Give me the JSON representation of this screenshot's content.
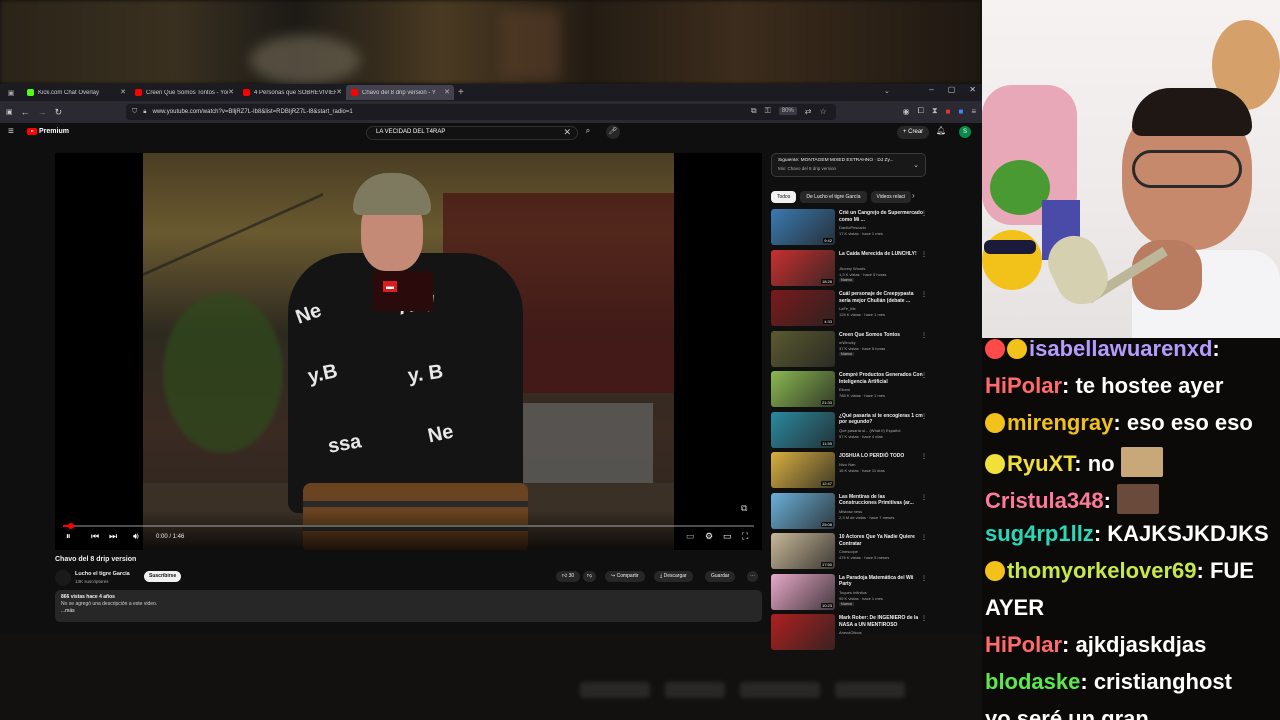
{
  "browser": {
    "tabs": [
      {
        "label": "Kick.com Chat Overlay",
        "color": "#53fc18"
      },
      {
        "label": "Creen Que Somos Tontos - You",
        "color": "#ff0000"
      },
      {
        "label": "4 Personas que SOBREVIVIERON",
        "color": "#ff0000"
      },
      {
        "label": "Chavo del 8 drip version - Y",
        "color": "#ff0000"
      }
    ],
    "url": "www.youtube.com/watch?v=BlljRZ7L-Ib8&list=RDBIjRZ7L-I8&start_radio=1",
    "zoom": "80%"
  },
  "youtube": {
    "logo": "Premium",
    "search_query": "LA VECIDAD DEL T4RAP",
    "create_label": "+ Crear",
    "avatar_letter": "S"
  },
  "video": {
    "time": "0:00 / 1:46",
    "progress": 0.012,
    "title": "Chavo del 8 drip version",
    "channel": "Lucho el tigre García",
    "subs": "13K suscriptores",
    "subscribe_label": "Suscribirse",
    "likes": "30",
    "share_label": "Compartir",
    "download_label": "Descargar",
    "save_label": "Guardar",
    "views": "866 vistas  hace 4 años",
    "description": "No se agregó una descripción a este video.",
    "more": "...más"
  },
  "upnext": {
    "line1": "Siguiente: MONTAGEM MIXED ESTRAHNO · DJ Zy...",
    "line2": "Mix: Chavo del 8 drip version"
  },
  "chips": [
    "Todos",
    "De Lucho el tigre García",
    "Videos relaci"
  ],
  "recommendations": [
    {
      "title": "Crié un Cangrejo de Supermercado como Mi ...",
      "channel": "DaniloPescado",
      "meta": "17 K vistas · hace 1 mes",
      "duration": "9:42",
      "thumb": "#3a7ab0",
      "nuevo": false
    },
    {
      "title": "La Caída Merecida de LUNCHLY!",
      "channel": "Jhonny Woods",
      "meta": "1,3 K vistas · hace 5 horas",
      "duration": "18:28",
      "thumb": "#c83030",
      "nuevo": true
    },
    {
      "title": "Cuál personaje de Creepypasta sería mejor Chulián (debate ...",
      "channel": "LaFe_Mx",
      "meta": "128 K vistas · hace 1 mes",
      "duration": "4:33",
      "thumb": "#7a1a1a",
      "nuevo": false
    },
    {
      "title": "Creen Que Somos Tontos",
      "channel": "mWrocky",
      "meta": "37 K vistas · hace 5 horas",
      "duration": "",
      "thumb": "#5a5a30",
      "nuevo": true
    },
    {
      "title": "Compré Productos Generados Con Inteligencia Artificial",
      "channel": "Ellonn",
      "meta": "788 K vistas · hace 1 mes",
      "duration": "21:33",
      "thumb": "#8ab850",
      "nuevo": false
    },
    {
      "title": "¿Qué pasaría si te encogieras 1 cm por segundo?",
      "channel": "Qué pasaría si... (What If) Español",
      "meta": "57 K vistas · hace 4 días",
      "duration": "11:55",
      "thumb": "#2a8aa0",
      "nuevo": false
    },
    {
      "title": "JOSHUA LO PERDIÓ TODO",
      "channel": "Nico Nan",
      "meta": "16 K vistas · hace 11 días",
      "duration": "12:47",
      "thumb": "#d8b040",
      "nuevo": false
    },
    {
      "title": "Las Mentiras de las Construcciones Primitivas (ar...",
      "channel": "Misbow ness",
      "meta": "2,3 M de vistas · hace 7 meses",
      "duration": "25:08",
      "thumb": "#6ab0d8",
      "nuevo": false
    },
    {
      "title": "10 Actores Que Ya Nadie Quiere Contratar",
      "channel": "Cinescope",
      "meta": "476 K vistas · hace 5 meses",
      "duration": "17:50",
      "thumb": "#c8b898",
      "nuevo": false
    },
    {
      "title": "La Paradoja Matemática del Wii Party",
      "channel": "Toques Infinitos",
      "meta": "95 K vistas · hace 1 mes",
      "duration": "10:23",
      "thumb": "#e8a8c8",
      "nuevo": true
    },
    {
      "title": "Mark Rober: De INGENIERO de la NASA a UN MENTIROSO",
      "channel": "AnecdOticos",
      "meta": "",
      "duration": "",
      "thumb": "#b02020",
      "nuevo": false
    }
  ],
  "chat": [
    {
      "user": "isabellawuarenxd",
      "color": "#b49cff",
      "text": ":",
      "badge": "#ff4a4a",
      "badge2": "#f2c21a"
    },
    {
      "user": "HiPolar",
      "color": "#ff6b6b",
      "text": ": te hostee ayer"
    },
    {
      "user": "mirengray",
      "color": "#f2c21a",
      "text": ": eso eso eso",
      "badge": "#f2c21a"
    },
    {
      "user": "RyuXT",
      "color": "#f2e03a",
      "text": ": no",
      "badge": "#f2e03a",
      "emote": "#c8a878"
    },
    {
      "user": "Cristula348",
      "color": "#ff7a9a",
      "text": ":",
      "emote": "#6a4a3a"
    },
    {
      "user": "sug4rp1llz",
      "color": "#2ad8b8",
      "text": ": KAJKSJKDJKS"
    },
    {
      "user": "thomyorkelover69",
      "color": "#c8e84a",
      "text": ": FUE",
      "badge": "#f2c21a"
    },
    {
      "user": "",
      "color": "#ffffff",
      "text": "AYER"
    },
    {
      "user": "HiPolar",
      "color": "#ff6b6b",
      "text": ": ajkdjaskdjas"
    },
    {
      "user": "blodaske",
      "color": "#5ae84a",
      "text": ": cristianghost"
    },
    {
      "user": "",
      "color": "#ffffff",
      "text": "yo seré un gran"
    }
  ]
}
